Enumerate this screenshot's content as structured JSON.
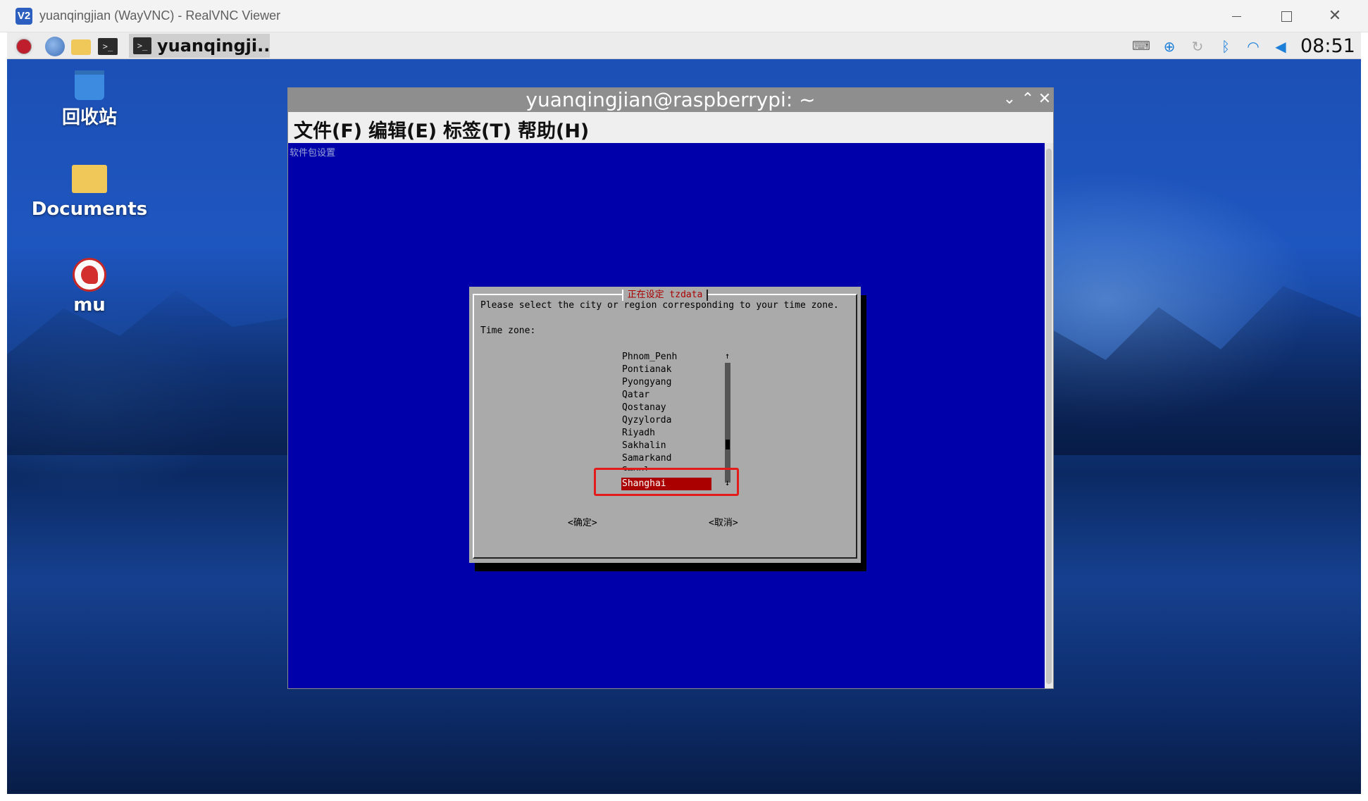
{
  "window": {
    "title": "yuanqingjian (WayVNC) - RealVNC Viewer",
    "app_icon_glyph": "V2",
    "min_glyph": "",
    "max_glyph": "",
    "close_glyph": "✕"
  },
  "taskbar": {
    "terminal_glyph": ">_",
    "active_task_label": "yuanqingji..",
    "clock": "08:51",
    "tray_glyphs": {
      "keyboard": "⌨",
      "download": "⊕",
      "sync": "↻",
      "bluetooth": "ᛒ",
      "wifi": "◠",
      "volume": "◀"
    },
    "icons": [
      "raspberry-icon",
      "browser-icon",
      "files-icon",
      "terminal-icon",
      "keyboard-icon",
      "download-icon",
      "sync-icon",
      "bluetooth-icon",
      "wifi-icon",
      "volume-icon"
    ]
  },
  "desktop": {
    "items": [
      {
        "label": "回收站",
        "icon": "trash-icon"
      },
      {
        "label": "Documents",
        "icon": "folder-icon"
      },
      {
        "label": "mu",
        "icon": "mu-icon"
      }
    ]
  },
  "terminal": {
    "title": "yuanqingjian@raspberrypi: ~",
    "controls": {
      "minimize": "⌄",
      "maximize": "⌃",
      "close": "✕"
    },
    "menu": [
      "文件(F)",
      "编辑(E)",
      "标签(T)",
      "帮助(H)"
    ],
    "backtitle": "软件包设置"
  },
  "dialog": {
    "title": "正在设定 tzdata",
    "prompt": "Please select the city or region corresponding to your time zone.",
    "label": "Time zone:",
    "options": [
      "Phnom_Penh",
      "Pontianak",
      "Pyongyang",
      "Qatar",
      "Qostanay",
      "Qyzylorda",
      "Riyadh",
      "Sakhalin",
      "Samarkand",
      "Seoul",
      "Shanghai"
    ],
    "selected": "Shanghai",
    "selected_index": 10,
    "scroll_up": "↑",
    "scroll_down": "↓",
    "ok": "<确定>",
    "cancel": "<取消>"
  },
  "colors": {
    "terminal_bg": "#0000aa",
    "dialog_bg": "#aaaaaa",
    "selection": "#aa0000",
    "annotation": "#e31b1b"
  }
}
